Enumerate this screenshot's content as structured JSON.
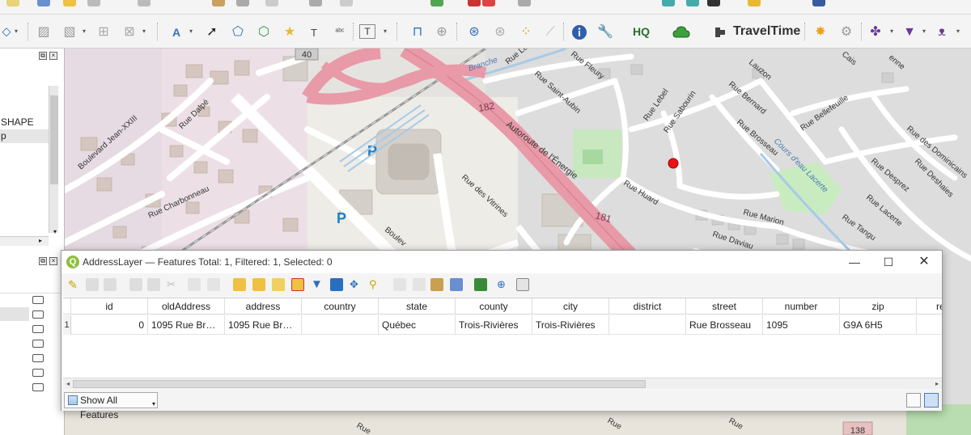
{
  "toolbar": {
    "travel_time_label": "TravelTime",
    "hq_label": "HQ"
  },
  "left_panel_top": {
    "items": [
      "SHAPE",
      "p"
    ]
  },
  "map": {
    "labels": {
      "road_40": "40",
      "road_182": "182",
      "road_181": "181",
      "road_138": "138",
      "autoroute": "Autoroute de l'Énergie",
      "boulevard_jean_xxiii": "Boulevard Jean-XXIII",
      "rue_dalpe": "Rue Dalpé",
      "rue_charbonneau": "Rue Charbonneau",
      "rue_des_vitrines": "Rue des Vitrines",
      "boulevard": "Boulev",
      "rue_saint_aubin": "Rue Saint-Aubin",
      "rue_leclerc": "Rue Le",
      "rue_fleury": "Rue Fleury",
      "rue_lebel": "Rue Lebel",
      "rue_sabourin": "Rue Sabourin",
      "rue_brosseau": "Rue Brosseau",
      "rue_huard": "Rue Huard",
      "rue_marion": "Rue Marion",
      "rue_daviau": "Rue Daviau",
      "rue_bernard": "Rue Bernard",
      "rue_bellefeuille": "Rue Bellefeuille",
      "rue_des_dominicains": "Rue des Dominicains",
      "rue_desprez": "Rue Desprez",
      "rue_deshaies": "Rue Deshaies",
      "rue_lacerte": "Rue Lacerte",
      "rue_tangu": "Rue Tangu",
      "cours_deau_lacerte": "Cours d'eau Lacerte",
      "parking": "P",
      "branche": "Branche",
      "rue_lauzon": "Lauzon",
      "rue_cais": "Cais",
      "rue_enne": "enne"
    }
  },
  "attribute_table": {
    "title": "AddressLayer — Features Total: 1, Filtered: 1, Selected: 0",
    "columns": [
      "id",
      "oldAddress",
      "address",
      "country",
      "state",
      "county",
      "city",
      "district",
      "street",
      "number",
      "zip",
      "re"
    ],
    "rows": [
      {
        "row_number": "1",
        "id": "0",
        "oldAddress": "1095 Rue Bross...",
        "address": "1095 Rue Bross...",
        "country": "",
        "state": "Québec",
        "county": "Trois-Rivières",
        "city": "Trois-Rivières",
        "district": "",
        "street": "Rue Brosseau",
        "number": "1095",
        "zip": "G9A 6H5"
      }
    ],
    "footer_button": "Show All Features"
  }
}
